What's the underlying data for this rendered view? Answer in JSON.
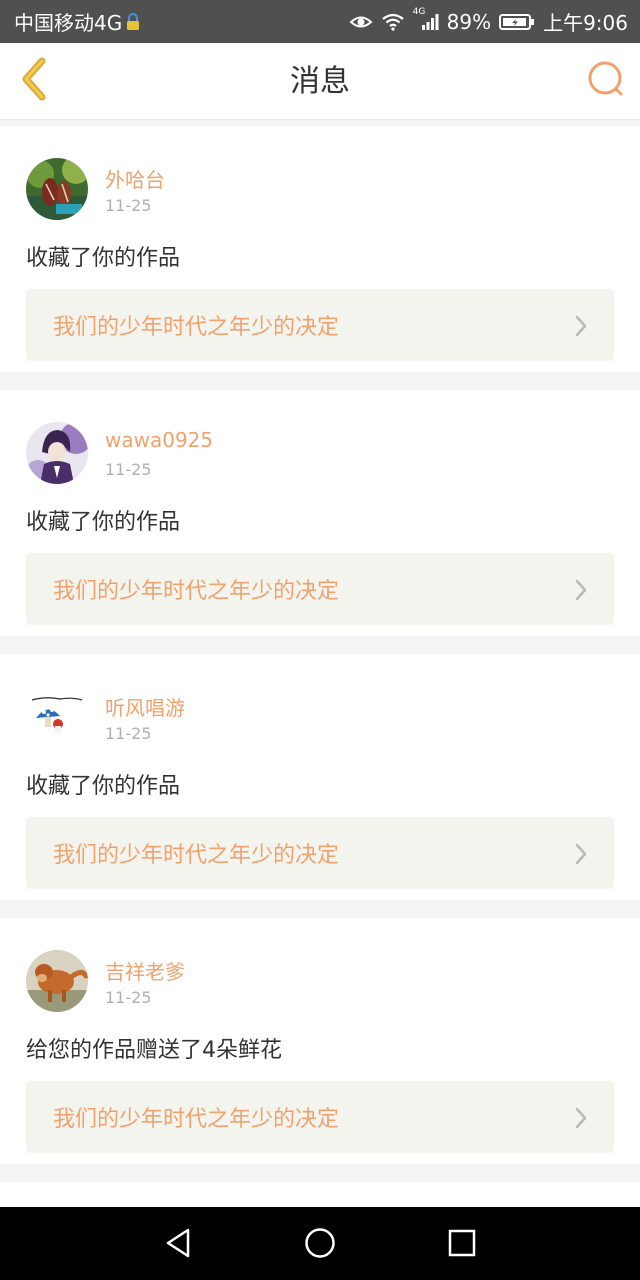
{
  "status_bar": {
    "carrier": "中国移动4G",
    "network": "4G",
    "battery": "89%",
    "time": "上午9:06"
  },
  "header": {
    "title": "消息"
  },
  "messages": [
    {
      "username": "外哈台",
      "date": "11-25",
      "action": "收藏了你的作品",
      "work_title": "我们的少年时代之年少的决定"
    },
    {
      "username": "wawa0925",
      "date": "11-25",
      "action": "收藏了你的作品",
      "work_title": "我们的少年时代之年少的决定"
    },
    {
      "username": "听风唱游",
      "date": "11-25",
      "action": "收藏了你的作品",
      "work_title": "我们的少年时代之年少的决定"
    },
    {
      "username": "吉祥老爹",
      "date": "11-25",
      "action": "给您的作品赠送了4朵鲜花",
      "work_title": "我们的少年时代之年少的决定"
    }
  ],
  "colors": {
    "accent": "#f0a26c",
    "back_arrow": "#e8b63c",
    "status_bar": "#505050"
  },
  "icons": {
    "back": "chevron-left-icon",
    "search": "search-icon",
    "row_arrow": "chevron-right-icon",
    "nav_back": "triangle-back-icon",
    "nav_home": "circle-home-icon",
    "nav_recent": "square-recent-icon"
  }
}
